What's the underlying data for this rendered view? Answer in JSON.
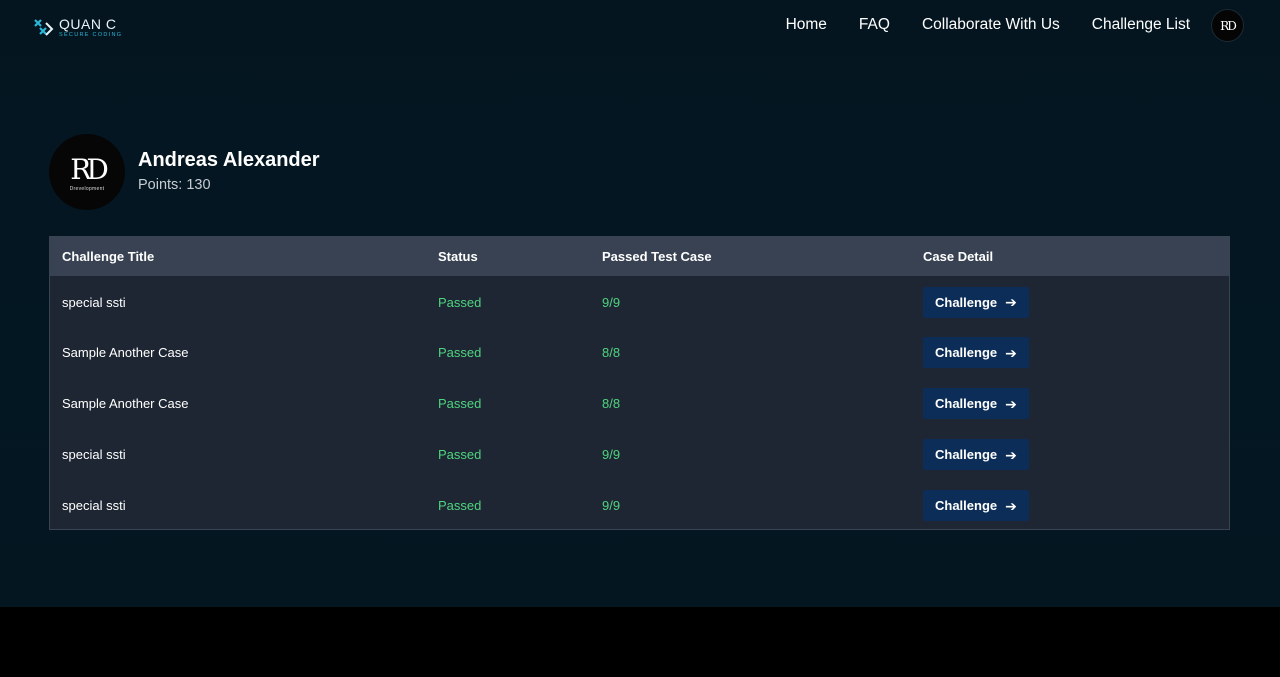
{
  "nav": {
    "logo_title": "QUAN C",
    "logo_subtitle": "SECURE CODING",
    "links": [
      "Home",
      "FAQ",
      "Collaborate With Us",
      "Challenge List"
    ],
    "avatar_monogram": "RD"
  },
  "profile": {
    "avatar_monogram": "RD",
    "avatar_caption": "Drevelopment",
    "name": "Andreas Alexander",
    "points": "Points: 130"
  },
  "table": {
    "headers": [
      "Challenge Title",
      "Status",
      "Passed Test Case",
      "Case Detail"
    ],
    "rows": [
      {
        "title": "special ssti",
        "status": "Passed",
        "passed": "9/9",
        "action": "Challenge"
      },
      {
        "title": "Sample Another Case",
        "status": "Passed",
        "passed": "8/8",
        "action": "Challenge"
      },
      {
        "title": "Sample Another Case",
        "status": "Passed",
        "passed": "8/8",
        "action": "Challenge"
      },
      {
        "title": "special ssti",
        "status": "Passed",
        "passed": "9/9",
        "action": "Challenge"
      },
      {
        "title": "special ssti",
        "status": "Passed",
        "passed": "9/9",
        "action": "Challenge"
      }
    ]
  },
  "colors": {
    "background": "#041520",
    "status_green": "#4ed47f",
    "button": "#0c2d57",
    "table_header": "#384252",
    "table_body": "#1f2633"
  },
  "icons": {
    "button_icon": "arrow-right-icon",
    "logo_icon": "quanc-logo-icon"
  }
}
